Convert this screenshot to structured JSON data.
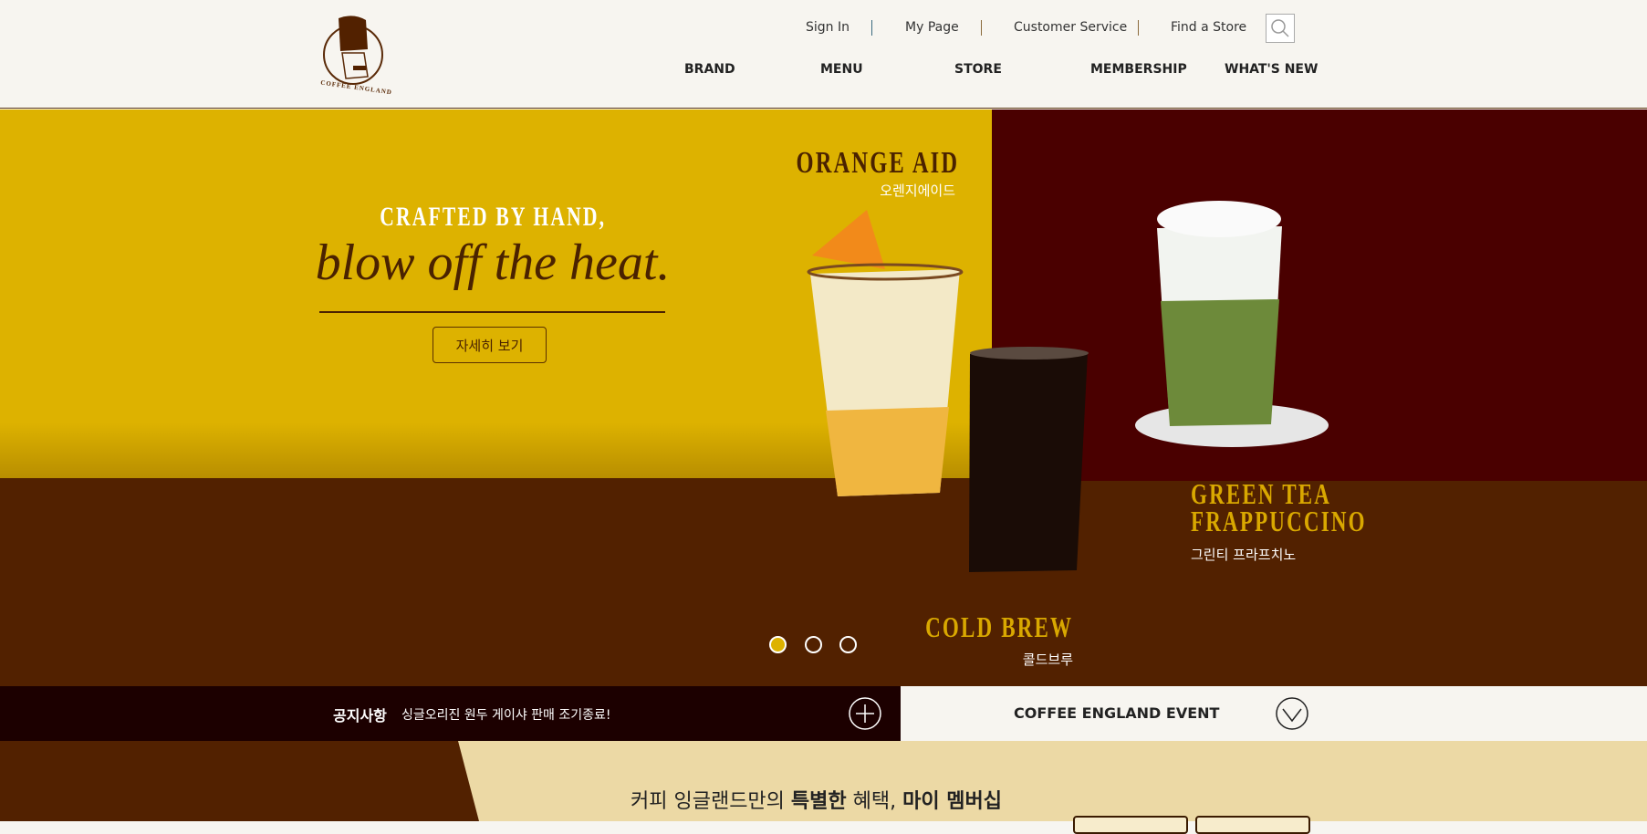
{
  "header": {
    "logo_text": "COFFEE ENGLAND",
    "top_links": [
      "Sign In",
      "My Page",
      "Customer Service",
      "Find a Store"
    ],
    "search_icon": "search-icon",
    "nav": [
      "BRAND",
      "MENU",
      "STORE",
      "MEMBERSHIP",
      "WHAT'S NEW"
    ]
  },
  "hero": {
    "headline": "CRAFTED BY HAND,",
    "tagline": "blow off the heat.",
    "detail_button": "자세히 보기",
    "products": [
      {
        "name": "ORANGE AID",
        "name_ko": "오렌지에이드"
      },
      {
        "name_line1": "GREEN TEA",
        "name_line2": "FRAPPUCCINO",
        "name_ko": "그린티 프라프치노"
      },
      {
        "name": "COLD BREW",
        "name_ko": "콜드브루"
      }
    ],
    "slide_count": 3,
    "active_slide": 1,
    "colors": {
      "yellow": "#ddb200",
      "maroon": "#4a0000",
      "brown": "#522100"
    }
  },
  "notice": {
    "label": "공지사항",
    "text": "싱글오리진 원두 게이샤 판매 조기종료!",
    "icon": "plus-circle-icon"
  },
  "event": {
    "label": "COFFEE ENGLAND EVENT",
    "icon": "chevron-down-circle-icon"
  },
  "membership": {
    "prefix": "커피 잉글랜드만의 ",
    "bold1": "특별한",
    "middle": " 혜택, ",
    "bold2": "마이 멤버십"
  }
}
